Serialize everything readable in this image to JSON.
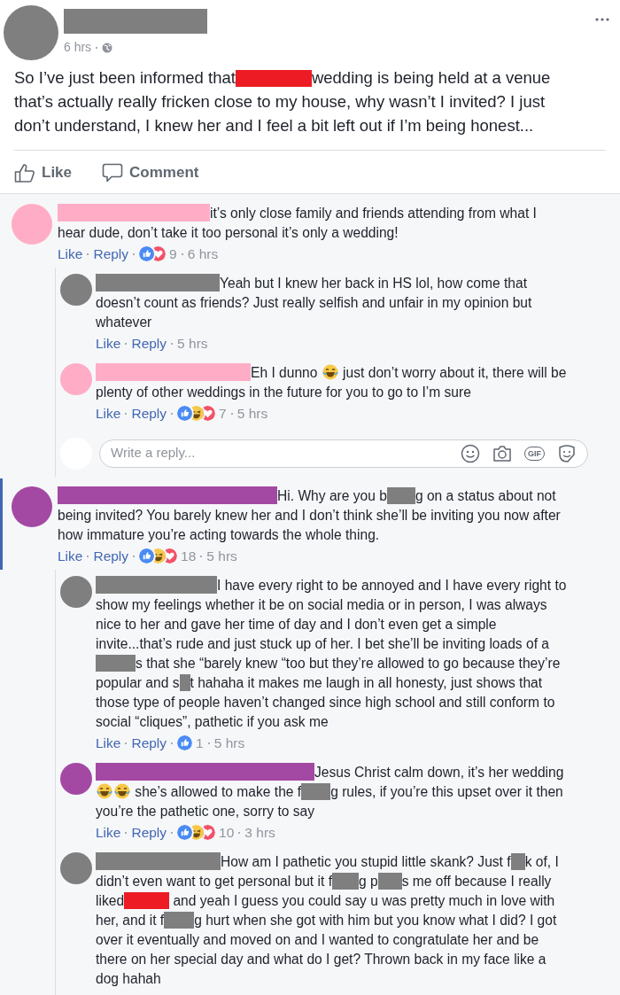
{
  "post": {
    "avatar": {
      "color": "#7f7f7f"
    },
    "name_bar": {
      "color": "#7f7f7f"
    },
    "time": "6 hrs",
    "body": [
      {
        "kind": "text",
        "text": "So I’ve just been informed that"
      },
      {
        "kind": "redacted",
        "color": "#ed1c24"
      },
      {
        "kind": "text",
        "text": "wedding is being held at a venue that’s actually really fricken close to my house, why wasn’t I invited? I just don’t understand, I knew her and I feel a bit left out if I’m being honest..."
      }
    ],
    "actions": [
      {
        "kind": "like",
        "label": "Like"
      },
      {
        "kind": "comment",
        "label": "Comment"
      }
    ]
  },
  "comments": [
    {
      "avatar": {
        "color": "#ffadc6"
      },
      "name_bar": {
        "color": "#ffadc6"
      },
      "highlighted": false,
      "body": [
        {
          "kind": "text",
          "text": "it’s only close family and friends attending from what I hear dude, don’t take it too personal it’s only a wedding!"
        }
      ],
      "like_label": "Like",
      "reply_label": "Reply",
      "reactions": [
        {
          "kind": "like"
        },
        {
          "kind": "love"
        }
      ],
      "reaction_count": "9",
      "time": "6 hrs",
      "replies": [
        {
          "avatar": {
            "color": "#7f7f7f"
          },
          "name_bar": {
            "color": "#7f7f7f"
          },
          "body": [
            {
              "kind": "text",
              "text": "Yeah but I knew her back in HS lol, how come that doesn’t count as friends? Just really selfish and unfair in my opinion but whatever"
            }
          ],
          "like_label": "Like",
          "reply_label": "Reply",
          "time": "5 hrs"
        },
        {
          "avatar": {
            "color": "#ffadc6"
          },
          "name_bar": {
            "color": "#ffadc6"
          },
          "body": [
            {
              "kind": "text",
              "text": "Eh I dunno "
            },
            {
              "kind": "emoji"
            },
            {
              "kind": "text",
              "text": " just don’t worry about it, there will be plenty of other weddings in the future for you to go to I’m sure"
            }
          ],
          "like_label": "Like",
          "reply_label": "Reply",
          "reactions": [
            {
              "kind": "like"
            },
            {
              "kind": "haha"
            },
            {
              "kind": "love"
            }
          ],
          "reaction_count": "7",
          "time": "5 hrs"
        }
      ],
      "reply_box": {
        "placeholder": "Write a reply...",
        "gif_label": "GIF"
      }
    },
    {
      "avatar": {
        "color": "#a349a4"
      },
      "name_bar": {
        "color": "#a349a4"
      },
      "highlighted": true,
      "body": [
        {
          "kind": "text",
          "text": "Hi. Why are you b"
        },
        {
          "kind": "redacted",
          "color": "#7f7f7f"
        },
        {
          "kind": "text",
          "text": "g on a status about not being invited? You barely knew her and I don’t think she’ll be inviting you now after how immature you’re acting towards the whole thing."
        }
      ],
      "like_label": "Like",
      "reply_label": "Reply",
      "reactions": [
        {
          "kind": "like"
        },
        {
          "kind": "haha"
        },
        {
          "kind": "love"
        }
      ],
      "reaction_count": "18",
      "time": "5 hrs",
      "replies": [
        {
          "avatar": {
            "color": "#7f7f7f"
          },
          "name_bar": {
            "color": "#7f7f7f"
          },
          "body": [
            {
              "kind": "text",
              "text": "I have every right to be annoyed and I have every right to show my feelings whether it be on social media or in person, I was always nice to her and gave her time of day and I don’t even get a simple invite...that’s rude and just stuck up of her. I bet she’ll be inviting loads of a"
            },
            {
              "kind": "redacted",
              "color": "#7f7f7f"
            },
            {
              "kind": "text",
              "text": "s that she “barely knew “too but they’re allowed to go because they’re popular and s"
            },
            {
              "kind": "redacted",
              "color": "#7f7f7f"
            },
            {
              "kind": "text",
              "text": "t hahaha it makes me laugh in all honesty, just shows that those type of people haven’t changed since high school and still conform to social “cliques”, pathetic if you ask me"
            }
          ],
          "like_label": "Like",
          "reply_label": "Reply",
          "reactions": [
            {
              "kind": "like"
            }
          ],
          "reaction_count": "1",
          "time": "5 hrs"
        },
        {
          "avatar": {
            "color": "#a349a4"
          },
          "name_bar": {
            "color": "#a349a4"
          },
          "body": [
            {
              "kind": "text",
              "text": "Jesus Christ calm down, it’s her wedding"
            },
            {
              "kind": "emoji"
            },
            {
              "kind": "emoji"
            },
            {
              "kind": "text",
              "text": " she’s allowed to make the f"
            },
            {
              "kind": "redacted",
              "color": "#7f7f7f"
            },
            {
              "kind": "text",
              "text": "g rules, if you’re this upset over it then you’re the pathetic one, sorry to say"
            }
          ],
          "like_label": "Like",
          "reply_label": "Reply",
          "reactions": [
            {
              "kind": "like"
            },
            {
              "kind": "haha"
            },
            {
              "kind": "love"
            }
          ],
          "reaction_count": "10",
          "time": "3 hrs"
        },
        {
          "avatar": {
            "color": "#7f7f7f"
          },
          "name_bar": {
            "color": "#7f7f7f"
          },
          "body": [
            {
              "kind": "text",
              "text": "How am I pathetic you stupid little skank? Just f"
            },
            {
              "kind": "redacted",
              "color": "#7f7f7f"
            },
            {
              "kind": "text",
              "text": "k of, I didn’t even want to get personal but it f"
            },
            {
              "kind": "redacted",
              "color": "#7f7f7f"
            },
            {
              "kind": "text",
              "text": "g p"
            },
            {
              "kind": "redacted",
              "color": "#7f7f7f"
            },
            {
              "kind": "text",
              "text": "s me off because I really liked"
            },
            {
              "kind": "redacted",
              "color": "#ed1c24"
            },
            {
              "kind": "text",
              "text": " and yeah I guess you could say u was pretty much in love with her, and it f"
            },
            {
              "kind": "redacted",
              "color": "#7f7f7f"
            },
            {
              "kind": "text",
              "text": "g hurt when she got with him but you know what I did? I got over it eventually and moved on and I wanted to congratulate her and be there on her special day and what do I get? Thrown back in my face like a dog hahah"
            }
          ]
        }
      ]
    }
  ]
}
